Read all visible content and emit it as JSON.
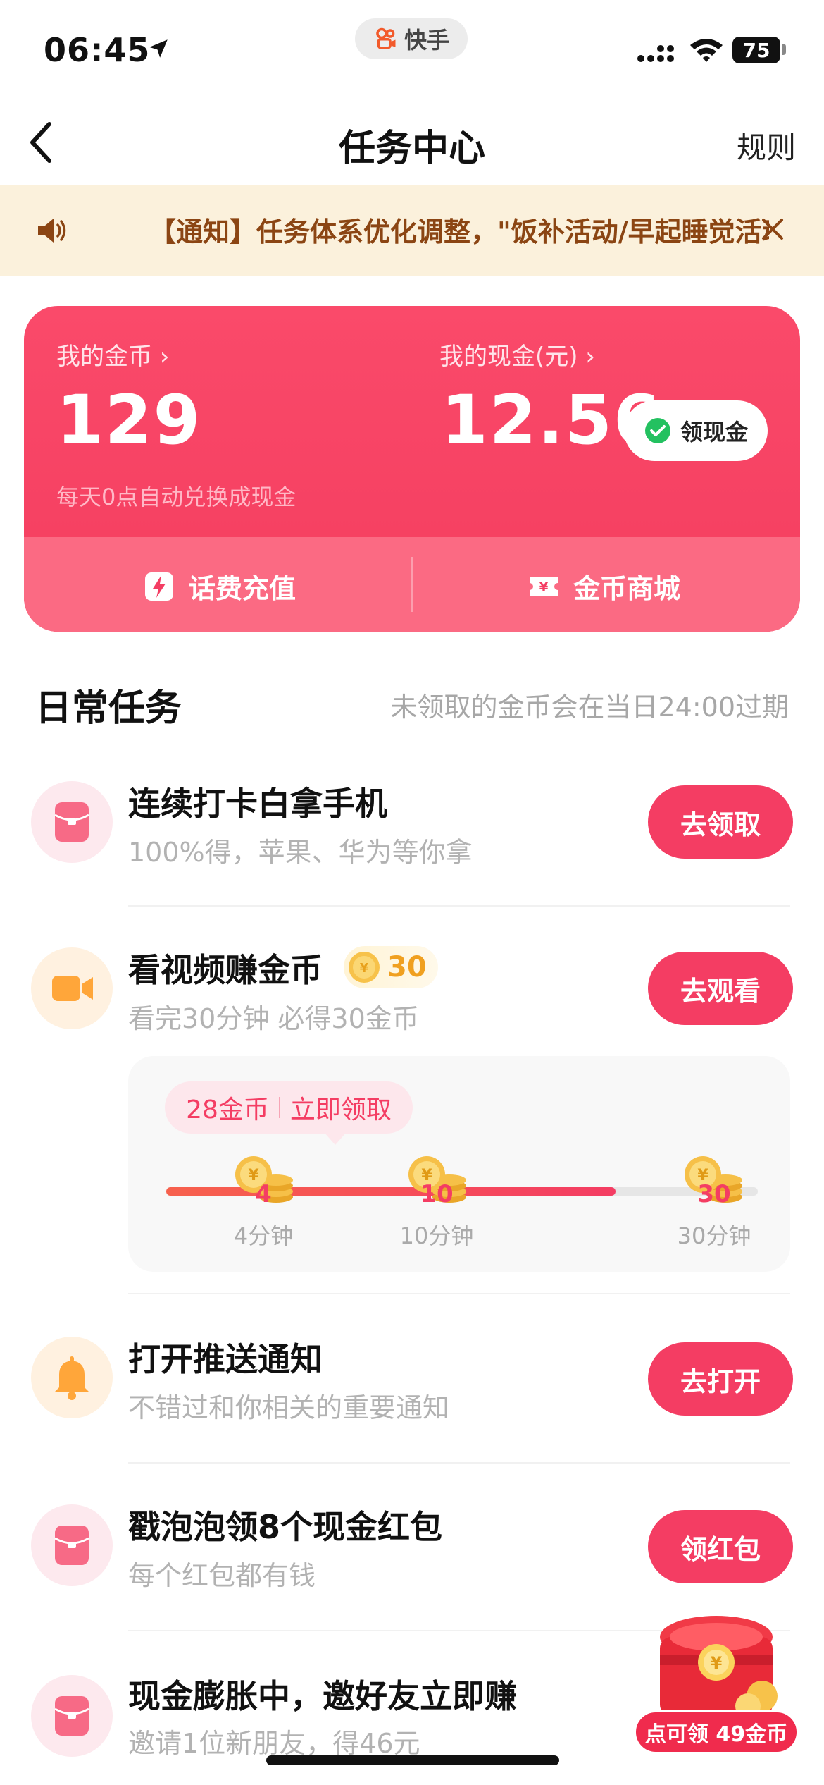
{
  "status_bar": {
    "time": "06:45",
    "app_name": "快手",
    "battery": "75"
  },
  "nav": {
    "title": "任务中心",
    "rules": "规则"
  },
  "notice": {
    "text": "【通知】任务体系优化调整，\"饭补活动/早起睡觉活动\""
  },
  "wallet": {
    "coins_label": "我的金币",
    "coins_value": "129",
    "coins_note": "每天0点自动兑换成现金",
    "cash_label": "我的现金(元)",
    "cash_value": "12.56",
    "withdraw_label": "领现金",
    "actions": [
      {
        "label": "话费充值",
        "icon": "lightning-icon"
      },
      {
        "label": "金币商城",
        "icon": "coupon-icon"
      }
    ]
  },
  "daily_tasks": {
    "title": "日常任务",
    "note": "未领取的金币会在当日24:00过期",
    "items": [
      {
        "title": "连续打卡白拿手机",
        "subtitle": "100%得，苹果、华为等你拿",
        "button": "去领取",
        "icon": "red-envelope-icon"
      },
      {
        "title": "看视频赚金币",
        "subtitle": "看完30分钟 必得30金币",
        "button": "去观看",
        "coin_reward": "30",
        "icon": "video-camera-icon"
      },
      {
        "title": "打开推送通知",
        "subtitle": "不错过和你相关的重要通知",
        "button": "去打开",
        "icon": "bell-icon"
      },
      {
        "title": "戳泡泡领8个现金红包",
        "subtitle": "每个红包都有钱",
        "button": "领红包",
        "icon": "red-envelope-icon"
      },
      {
        "title": "现金膨胀中，邀好友立即赚",
        "subtitle": "邀请1位新朋友，得46元",
        "icon": "red-envelope-icon"
      }
    ]
  },
  "video_progress": {
    "claim_coins": "28金币",
    "claim_action": "立即领取",
    "progress_fraction": 0.76,
    "milestones": [
      {
        "coins": "4",
        "label": "4分钟"
      },
      {
        "coins": "10",
        "label": "10分钟"
      },
      {
        "coins": "30",
        "label": "30分钟"
      }
    ]
  },
  "floating_reward": {
    "label": "点可领 49金币"
  },
  "colors": {
    "accent": "#f43d63",
    "notice_bg": "#fbf1dc",
    "notice_text": "#8b4513"
  }
}
